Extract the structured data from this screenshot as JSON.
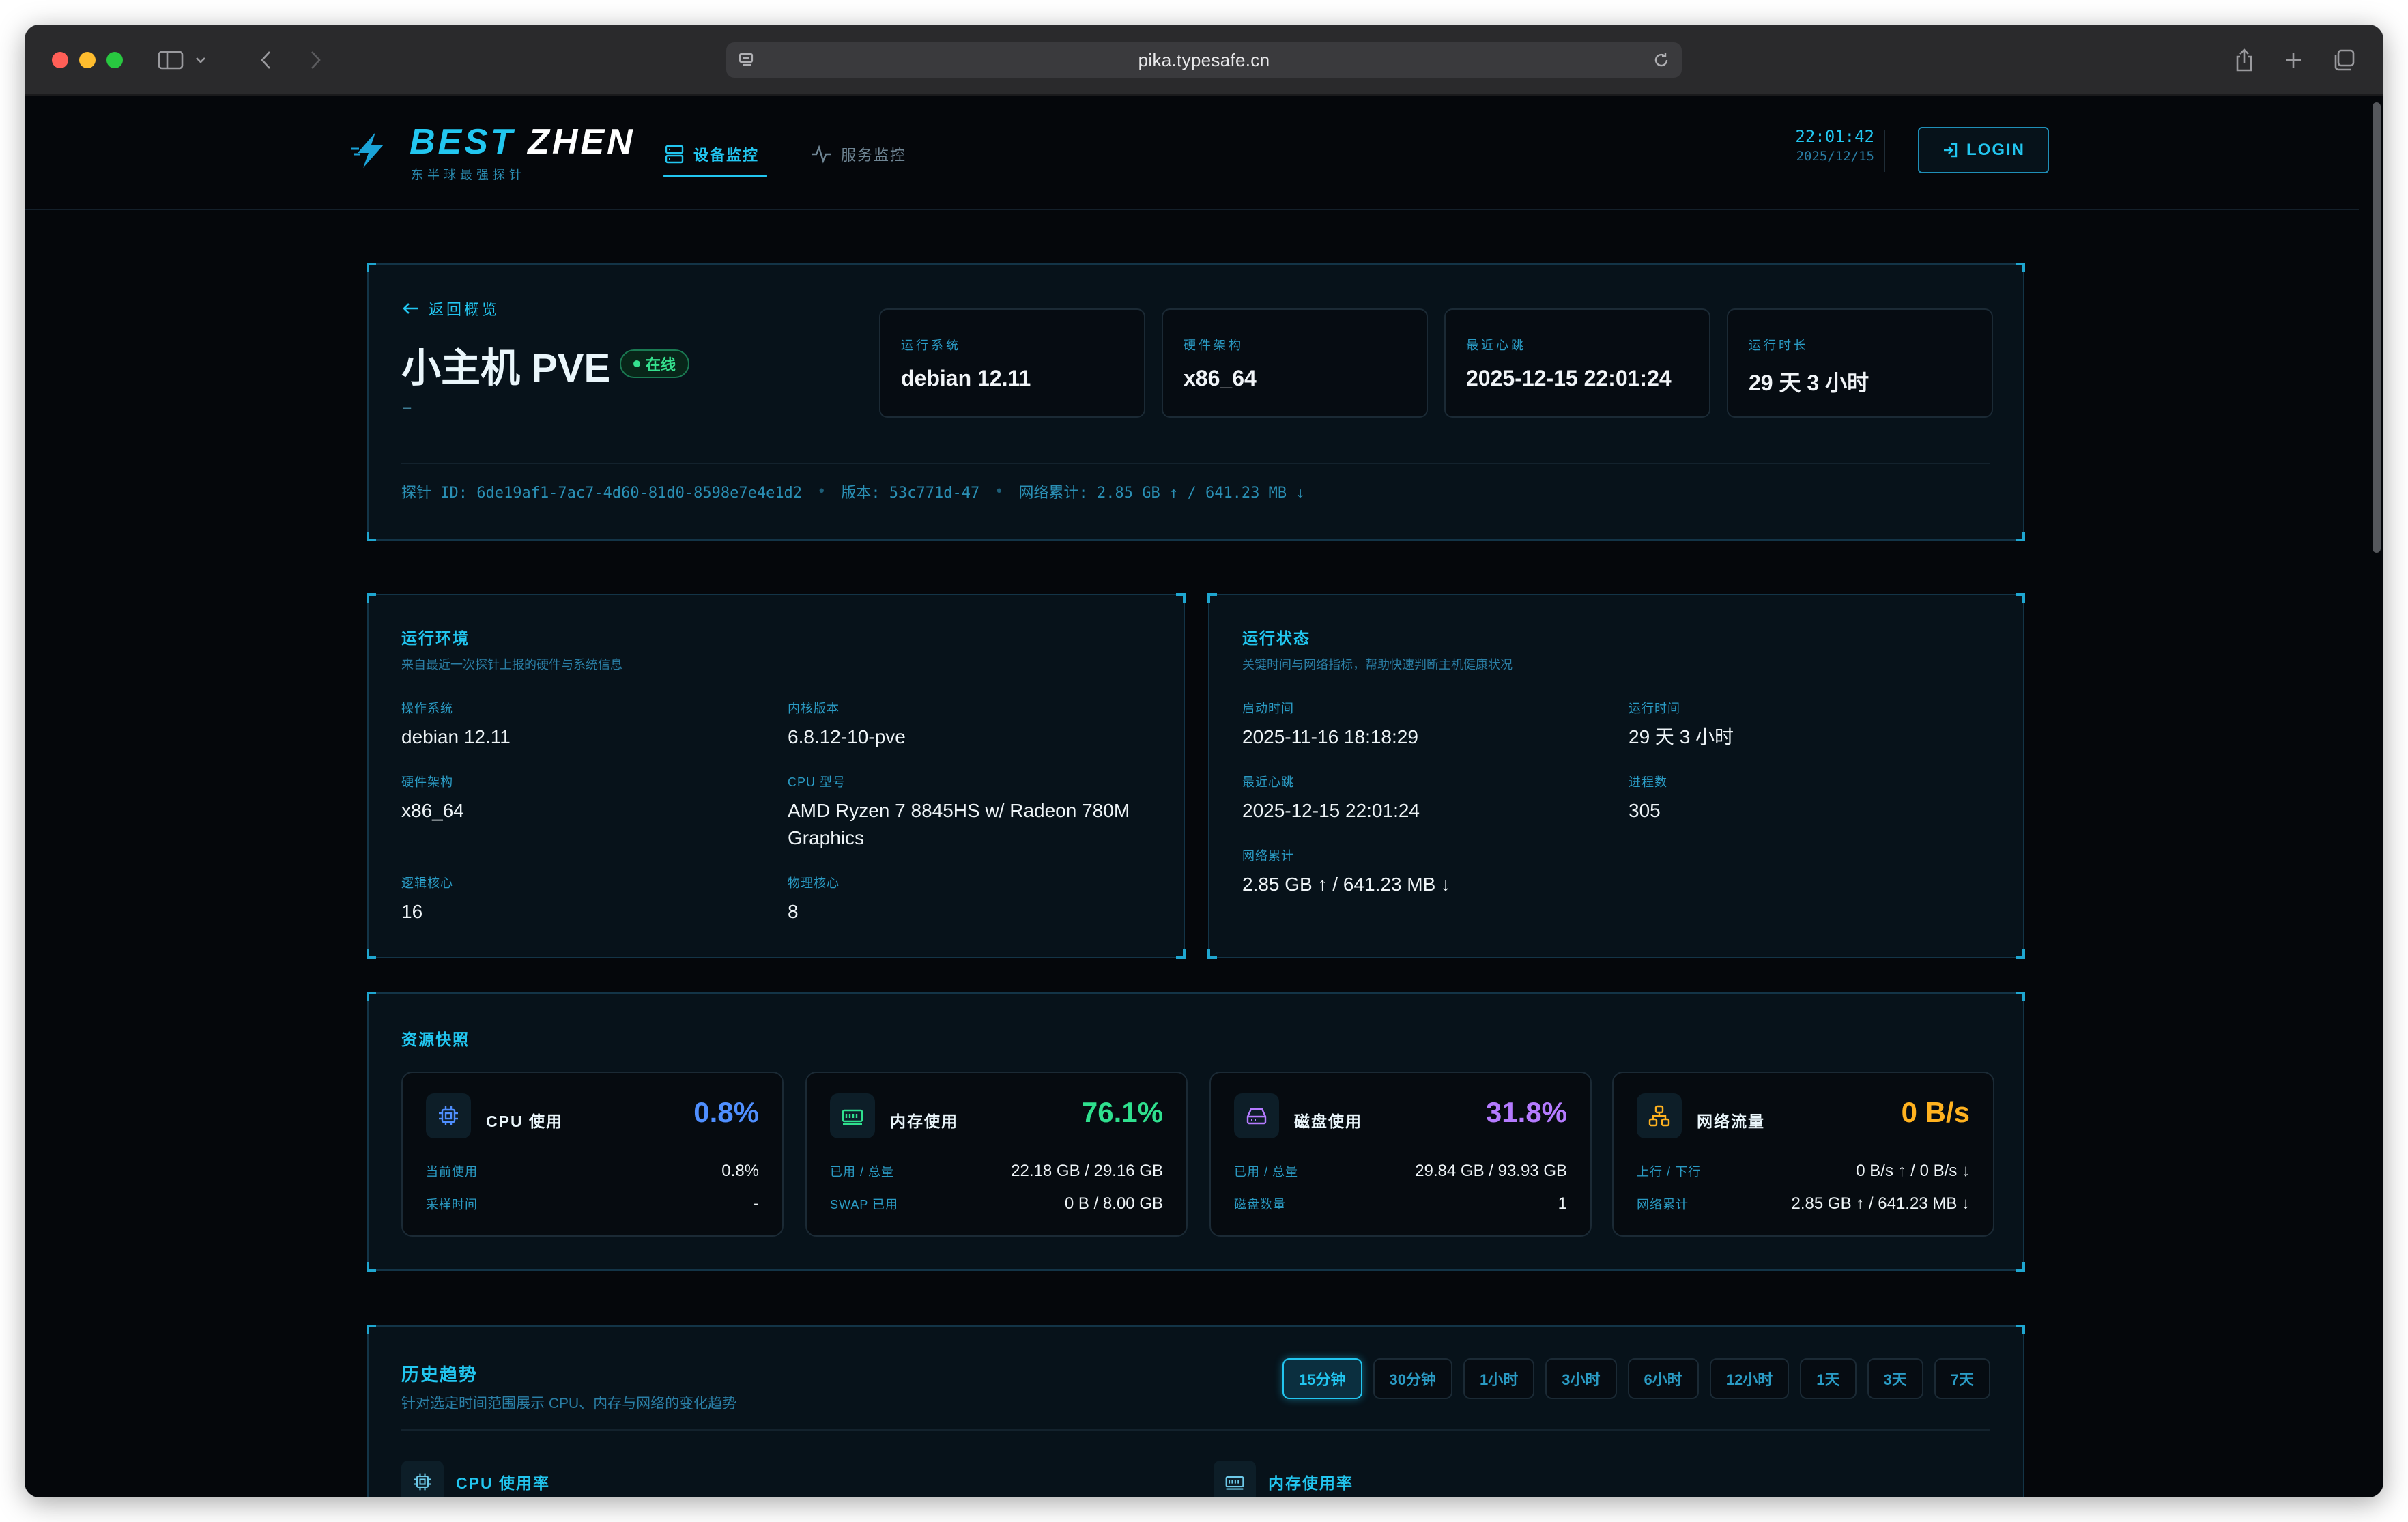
{
  "browser": {
    "url": "pika.typesafe.cn"
  },
  "header": {
    "brand_a": "BEST",
    "brand_b": "ZHEN",
    "brand_sub": "东半球最强探针",
    "nav": [
      {
        "label": "设备监控",
        "icon": "server-icon",
        "active": true
      },
      {
        "label": "服务监控",
        "icon": "activity-icon",
        "active": false
      }
    ],
    "time": "22:01:42",
    "date": "2025/12/15",
    "login_label": "LOGIN"
  },
  "host": {
    "back_label": "返回概览",
    "title": "小主机 PVE",
    "status": "在线",
    "description": "–",
    "stats": [
      {
        "label": "运行系统",
        "value": "debian 12.11"
      },
      {
        "label": "硬件架构",
        "value": "x86_64"
      },
      {
        "label": "最近心跳",
        "value": "2025-12-15 22:01:24"
      },
      {
        "label": "运行时长",
        "value": "29 天 3 小时"
      }
    ],
    "probe_id": "探针 ID: 6de19af1-7ac7-4d60-81d0-8598e7e4e1d2",
    "version": "版本: 53c771d-47",
    "net_total": "网络累计: 2.85 GB ↑ / 641.23 MB ↓"
  },
  "env": {
    "title": "运行环境",
    "subtitle": "来自最近一次探针上报的硬件与系统信息",
    "items": [
      {
        "key": "操作系统",
        "value": "debian 12.11"
      },
      {
        "key": "内核版本",
        "value": "6.8.12-10-pve"
      },
      {
        "key": "硬件架构",
        "value": "x86_64"
      },
      {
        "key": "CPU 型号",
        "value": "AMD Ryzen 7 8845HS w/ Radeon 780M Graphics"
      },
      {
        "key": "逻辑核心",
        "value": "16"
      },
      {
        "key": "物理核心",
        "value": "8"
      }
    ]
  },
  "status": {
    "title": "运行状态",
    "subtitle": "关键时间与网络指标，帮助快速判断主机健康状况",
    "items": [
      {
        "key": "启动时间",
        "value": "2025-11-16 18:18:29"
      },
      {
        "key": "运行时间",
        "value": "29 天 3 小时"
      },
      {
        "key": "最近心跳",
        "value": "2025-12-15 22:01:24"
      },
      {
        "key": "进程数",
        "value": "305"
      },
      {
        "key": "网络累计",
        "value": "2.85 GB ↑ / 641.23 MB ↓"
      }
    ]
  },
  "resources": {
    "title": "资源快照",
    "cards": [
      {
        "name": "CPU 使用",
        "icon": "cpu-icon",
        "value": "0.8%",
        "color": "#4f8fff",
        "rows": [
          {
            "k": "当前使用",
            "v": "0.8%"
          },
          {
            "k": "采样时间",
            "v": "-"
          }
        ]
      },
      {
        "name": "内存使用",
        "icon": "memory-icon",
        "value": "76.1%",
        "color": "#2fe08e",
        "rows": [
          {
            "k": "已用 / 总量",
            "v": "22.18 GB / 29.16 GB"
          },
          {
            "k": "SWAP 已用",
            "v": "0 B / 8.00 GB"
          }
        ]
      },
      {
        "name": "磁盘使用",
        "icon": "hard-drive-icon",
        "value": "31.8%",
        "color": "#b57bff",
        "rows": [
          {
            "k": "已用 / 总量",
            "v": "29.84 GB / 93.93 GB"
          },
          {
            "k": "磁盘数量",
            "v": "1"
          }
        ]
      },
      {
        "name": "网络流量",
        "icon": "network-icon",
        "value": "0 B/s",
        "color": "#ffb21f",
        "rows": [
          {
            "k": "上行 / 下行",
            "v": "0 B/s ↑ / 0 B/s ↓"
          },
          {
            "k": "网络累计",
            "v": "2.85 GB ↑ / 641.23 MB ↓"
          }
        ]
      }
    ]
  },
  "history": {
    "title": "历史趋势",
    "subtitle": "针对选定时间范围展示 CPU、内存与网络的变化趋势",
    "ranges": [
      "15分钟",
      "30分钟",
      "1小时",
      "3小时",
      "6小时",
      "12小时",
      "1天",
      "3天",
      "7天"
    ],
    "active_range": "15分钟",
    "charts": [
      {
        "label": "CPU 使用率",
        "icon": "cpu-icon"
      },
      {
        "label": "内存使用率",
        "icon": "memory-icon"
      }
    ]
  },
  "colors": {
    "accent": "#22c6f0",
    "online": "#35e08e",
    "background": "#05070b"
  }
}
